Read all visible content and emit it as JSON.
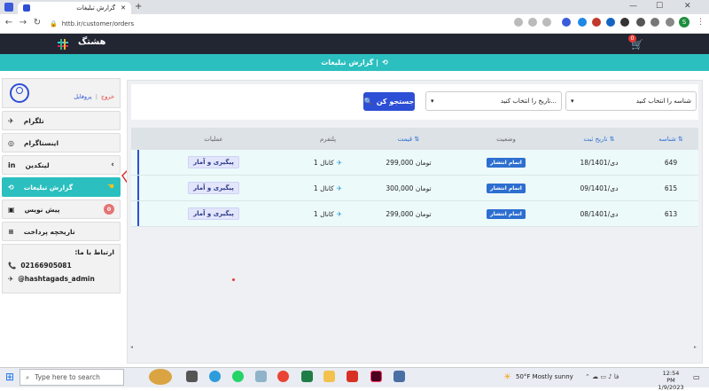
{
  "browser": {
    "tab_title": "گزارش تبلیغات",
    "url": "httb.ir/customer/orders",
    "profile_initial": "S"
  },
  "site": {
    "brand": "هشتگ",
    "cart_count": "0",
    "page_heading": "گزارش تبلیغات | "
  },
  "sidebar": {
    "profile_link": "پروفایل",
    "logout_link": "خروج",
    "items": [
      {
        "label": "تلگرام",
        "icon": "telegram-icon"
      },
      {
        "label": "اینستاگرام",
        "icon": "instagram-icon"
      },
      {
        "label": "لینکدین",
        "icon": "linkedin-icon"
      },
      {
        "label": "گزارش تبلیغات",
        "icon": "history-icon"
      },
      {
        "label": "پیش نویس",
        "icon": "draft-icon",
        "badge": "0"
      },
      {
        "label": "تاریخچه پرداخت",
        "icon": "coins-icon"
      }
    ],
    "contact_title": "ارتباط با ما:",
    "phone": "02166905081",
    "telegram_handle": "@hashtagads_admin"
  },
  "filter": {
    "id_select_placeholder": "شناسه را انتخاب کنید",
    "date_select_placeholder": "تاریخ را انتخاب کنید...",
    "search_label": "جستجو کن"
  },
  "table": {
    "headers": {
      "id": "شناسه",
      "date": "تاریخ ثبت",
      "status": "وضعیت",
      "price": "قیمت",
      "platform": "پلتفرم",
      "ops": "عملیات"
    },
    "rows": [
      {
        "id": "649",
        "date": "18/دی/1401",
        "status": "اتمام انتشار",
        "price": "299,000 تومان",
        "platform": "1 کانال",
        "ops": "پیگیری و آمار"
      },
      {
        "id": "615",
        "date": "09/دی/1401",
        "status": "اتمام انتشار",
        "price": "300,000 تومان",
        "platform": "1 کانال",
        "ops": "پیگیری و آمار"
      },
      {
        "id": "613",
        "date": "08/دی/1401",
        "status": "اتمام انتشار",
        "price": "299,000 تومان",
        "platform": "1 کانال",
        "ops": "پیگیری و آمار"
      }
    ]
  },
  "taskbar": {
    "search_placeholder": "Type here to search",
    "weather": "50°F  Mostly sunny",
    "time": "12:54 PM",
    "date": "1/9/2023"
  }
}
